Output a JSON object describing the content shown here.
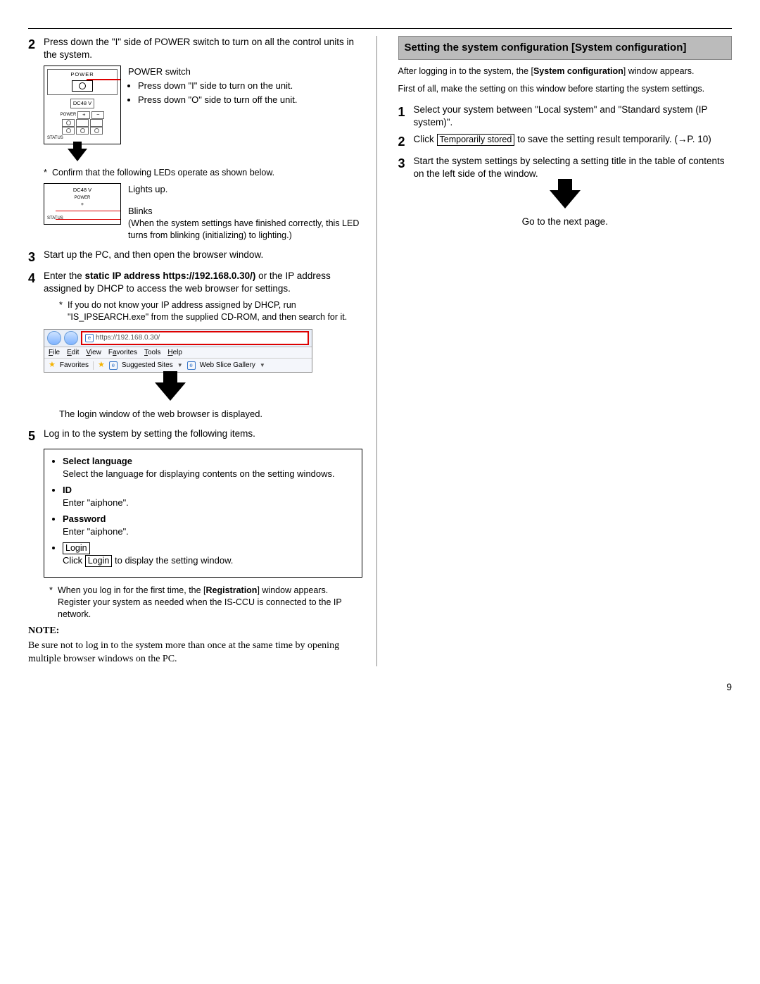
{
  "left": {
    "step2": "Press down the \"I\" side of POWER switch to turn on all the control units in the system.",
    "fig1": {
      "power": "POWER",
      "dc": "DC48 V",
      "pwr": "POWER",
      "status": "STATUS",
      "plus": "+",
      "minus": "−"
    },
    "callout1_title": "POWER switch",
    "callout1_a": "Press down \"I\" side to turn on the unit.",
    "callout1_b": "Press down \"O\" side to turn off the unit.",
    "led_note": "Confirm that the following LEDs operate as shown below.",
    "lights": "Lights up.",
    "blinks": "Blinks",
    "blinks_detail": "(When the system settings have finished correctly, this LED turns from blinking (initializing) to lighting.)",
    "step3": "Start up the PC, and then open the browser window.",
    "step4_a": "Enter the ",
    "step4_b": "static IP address https://192.168.0.30/)",
    "step4_c": " or the IP address assigned by DHCP to access the web browser for settings.",
    "step4_note": "If you do not know your IP address assigned by DHCP, run \"IS_IPSEARCH.exe\" from the supplied CD-ROM, and then search for it.",
    "browser": {
      "url": "https://192.168.0.30/",
      "menu": [
        "File",
        "Edit",
        "View",
        "Favorites",
        "Tools",
        "Help"
      ],
      "fav": "Favorites",
      "sug": "Suggested Sites",
      "slice": "Web Slice Gallery"
    },
    "login_shown": "The login window of the web browser is displayed.",
    "step5": "Log in to the system by setting the following items.",
    "login": {
      "sel_lang": "Select language",
      "sel_lang_body": "Select the language for displaying contents on the setting windows.",
      "id": "ID",
      "id_body": "Enter \"aiphone\".",
      "pw": "Password",
      "pw_body": "Enter \"aiphone\".",
      "login_btn": "Login",
      "login_body_a": "Click ",
      "login_body_b": " to display the setting window."
    },
    "first_login_a": "When you log in for the first time, the [",
    "first_login_b": "Registration",
    "first_login_c": "] window appears. Register your system as needed when the IS-CCU is connected to the IP network.",
    "note_head": "NOTE:",
    "note_body": "Be sure not to log in to the system more than once at the same time by opening multiple browser windows on the PC."
  },
  "right": {
    "heading": "Setting the system configuration [System configuration]",
    "intro_a": "After logging in to the system, the [",
    "intro_b": "System configuration",
    "intro_c": "] window appears.",
    "intro2": "First of all, make the setting on this window before starting the system settings.",
    "step1": "Select your system between \"Local system\" and \"Standard system (IP system)\".",
    "step2_a": "Click ",
    "step2_btn": "Temporarily stored",
    "step2_b": " to save the setting result temporarily. (→P. 10)",
    "step3": "Start the system settings by selecting a setting title in the table of contents on the left side of the window.",
    "next": "Go to the next page."
  },
  "page_number": "9"
}
